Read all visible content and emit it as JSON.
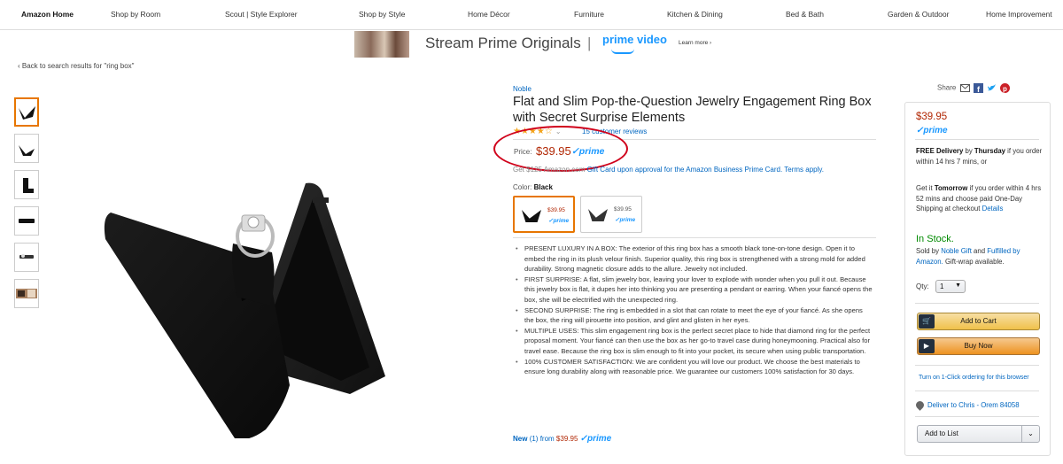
{
  "nav": {
    "items": [
      "Amazon Home",
      "Shop by Room",
      "Scout | Style Explorer",
      "Shop by Style",
      "Home Décor",
      "Furniture",
      "Kitchen & Dining",
      "Bed & Bath",
      "Garden & Outdoor",
      "Home Improvement"
    ]
  },
  "banner": {
    "text": "Stream Prime Originals",
    "separator": "|",
    "logo": "prime video",
    "learn_more": "Learn more ›"
  },
  "back_link": "‹ Back to search results for \"ring box\"",
  "product": {
    "brand": "Noble",
    "title": "Flat and Slim Pop-the-Question Jewelry Engagement Ring Box with Secret Surprise Elements",
    "stars": "★★★★☆",
    "rating": 4.5,
    "reviews": "15 customer reviews",
    "price_label": "Price:",
    "price": "$39.95",
    "prime": "✓prime",
    "gift_card_strike": "Get $125 Amazon.com",
    "gift_card": "Gift Card upon approval for the Amazon Business Prime Card. Terms apply.",
    "color_label": "Color:",
    "color_value": "Black",
    "swatches": [
      {
        "price": "$39.95",
        "prime": "✓prime"
      },
      {
        "price": "$39.95",
        "prime": "✓prime"
      }
    ],
    "bullets": [
      "PRESENT LUXURY IN A BOX: The exterior of this ring box has a smooth black tone-on-tone design. Open it to embed the ring in its plush velour finish. Superior quality, this ring box is strengthened with a strong mold for added durability. Strong magnetic closure adds to the allure. Jewelry not included.",
      "FIRST SURPRISE: A flat, slim jewelry box, leaving your lover to explode with wonder when you pull it out. Because this jewelry box is flat, it dupes her into thinking you are presenting a pendant or earring. When your fiancé opens the box, she will be electrified with the unexpected ring.",
      "SECOND SURPRISE: The ring is embedded in a slot that can rotate to meet the eye of your fiancé. As she opens the box, the ring will pirouette into position, and glint and glisten in her eyes.",
      "MULTIPLE USES: This slim engagement ring box is the perfect secret place to hide that diamond ring for the perfect proposal moment. Your fiancé can then use the box as her go-to travel case during honeymooning. Practical also for travel ease. Because the ring box is slim enough to fit into your pocket, its secure when using public transportation.",
      "100% CUSTOMER SATISFACTION: We are confident you will love our product. We choose the best materials to ensure long durability along with reasonable price. We guarantee our customers 100% satisfaction for 30 days."
    ],
    "new_offer_label": "New",
    "new_offer_count": "(1) from",
    "new_offer_price": "$39.95",
    "new_offer_prime": "✓prime"
  },
  "buybox": {
    "share_label": "Share",
    "price": "$39.95",
    "prime": "✓prime",
    "free_delivery": "FREE Delivery",
    "by": "by",
    "delivery_day": "Thursday",
    "delivery_cond": "if you order within 14 hrs 7 mins, or",
    "get_it": "Get it",
    "tomorrow": "Tomorrow",
    "tomorrow_cond": "if you order within 4 hrs 52 mins and choose paid One-Day Shipping at checkout",
    "details": "Details",
    "in_stock": "In Stock.",
    "sold_by": "Sold by",
    "seller": "Noble Gift",
    "and": "and",
    "fulfilled": "Fulfilled by Amazon.",
    "gift_wrap": "Gift-wrap available.",
    "qty_label": "Qty:",
    "qty_value": "1",
    "add_to_cart": "Add to Cart",
    "buy_now": "Buy Now",
    "one_click": "Turn on 1-Click ordering for this browser",
    "deliver_to": "Deliver to Chris - Orem 84058",
    "add_to_list": "Add to List"
  },
  "colors": {
    "price": "#b12704",
    "link": "#0066c0",
    "prime": "#1a98ff",
    "in_stock": "#008a00",
    "highlight_circle": "#d0021b"
  }
}
